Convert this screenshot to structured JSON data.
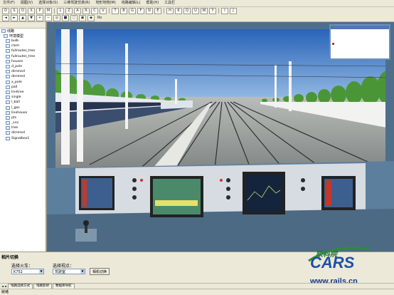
{
  "menu": [
    "文件(F)",
    "视图(V)",
    "选择对象(S)",
    "三维驾驶仿真(R)",
    "地形地物(M)",
    "线路编辑(L)",
    "帮助(H)",
    "工具栏"
  ],
  "toolbar": {
    "row1": [
      "D",
      "S",
      "O",
      "X",
      "P",
      "M",
      "L",
      "Z",
      "A",
      "R",
      "C",
      "V",
      "T",
      "B",
      "G",
      "F",
      "N",
      "E",
      "H",
      "K",
      "Q",
      "U",
      "W",
      "Y",
      "I",
      "J"
    ],
    "row2": [
      "◄",
      "►",
      "▲",
      "▼",
      "+",
      "−",
      "◎",
      "■",
      "□",
      "▣",
      "◆"
    ],
    "row2_text": "Ro"
  },
  "tree": {
    "root": "线路",
    "sub": "环境模型",
    "items": [
      "bulb",
      "clam",
      "fullroutes_tree",
      "fullroutes_tree",
      "houses",
      "d_pole",
      "dimmed",
      "dimmed",
      "x_pole",
      "pall",
      "linetree",
      "single",
      "l_ball",
      "l_gas",
      "linehouse",
      "pts",
      "_sco",
      "tree",
      "dimmed",
      "Signalbox1"
    ]
  },
  "bottom_panel": {
    "title": "相片切换",
    "train_label": "选择火车：",
    "train_value": "K752",
    "view_label": "选择视点：",
    "view_value": "驾驶室",
    "switch_button": "相机切换"
  },
  "tabs": [
    "线路选择方式",
    "线路影射",
    "数据库导航"
  ],
  "status": "就绪",
  "watermark": {
    "cn": "铁科院",
    "logo": "CARS",
    "url": "www.rails.cn"
  },
  "colors": {
    "sky": "#2c6fc4",
    "ground": "#c8ccc8",
    "cab": "#4f6f88",
    "logo_blue": "#1d4fa8",
    "logo_green": "#2e8b3e"
  }
}
